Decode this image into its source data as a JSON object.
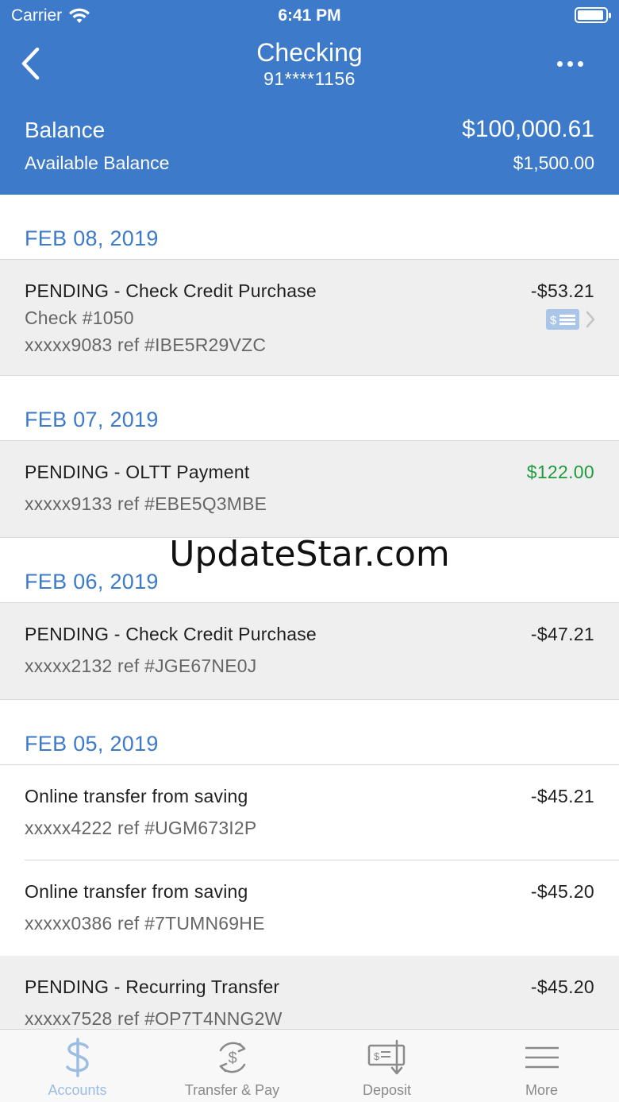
{
  "status_bar": {
    "carrier": "Carrier",
    "time": "6:41 PM",
    "battery_level": 0.95
  },
  "nav": {
    "title": "Checking",
    "subtitle": "91****1156"
  },
  "balance": {
    "label": "Balance",
    "value": "$100,000.61",
    "available_label": "Available Balance",
    "available_value": "$1,500.00"
  },
  "groups": [
    {
      "date": "FEB 08, 2019",
      "txns": [
        {
          "desc": "PENDING - Check Credit Purchase",
          "check": "Check #1050",
          "ref": "xxxxx9083 ref #IBE5R29VZC",
          "amount": "-$53.21"
        }
      ]
    },
    {
      "date": "FEB 07, 2019",
      "txns": [
        {
          "desc": "PENDING - OLTT Payment",
          "ref": "xxxxx9133 ref #EBE5Q3MBE",
          "amount": "$122.00"
        }
      ]
    },
    {
      "date": "FEB 06, 2019",
      "txns": [
        {
          "desc": "PENDING - Check Credit Purchase",
          "ref": "xxxxx2132 ref #JGE67NE0J",
          "amount": "-$47.21"
        }
      ]
    },
    {
      "date": "FEB 05, 2019",
      "txns": [
        {
          "desc": "Online transfer from saving",
          "ref": "xxxxx4222 ref #UGM673I2P",
          "amount": "-$45.21"
        },
        {
          "desc": "Online transfer from saving",
          "ref": "xxxxx0386 ref #7TUMN69HE",
          "amount": "-$45.20"
        },
        {
          "desc": "PENDING - Recurring Transfer",
          "ref": "xxxxx7528 ref #OP7T4NNG2W",
          "amount": "-$45.20"
        }
      ]
    }
  ],
  "watermark": "UpdateStar.com",
  "tabs": [
    {
      "label": "Accounts",
      "icon": "dollar-icon"
    },
    {
      "label": "Transfer & Pay",
      "icon": "transfer-pay-icon"
    },
    {
      "label": "Deposit",
      "icon": "deposit-check-icon"
    },
    {
      "label": "More",
      "icon": "menu-icon"
    }
  ],
  "colors": {
    "header": "#3d7ac9",
    "accent": "#3d7ac9",
    "positive": "#1e9b3c",
    "pending_bg": "#efefef"
  }
}
